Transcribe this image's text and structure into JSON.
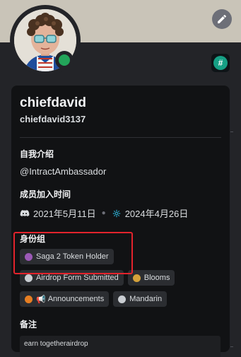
{
  "profile": {
    "display_name": "chiefdavid",
    "username": "chiefdavid3137"
  },
  "about": {
    "title": "自我介绍",
    "text": "@IntractAmbassador"
  },
  "member_since": {
    "title": "成员加入时间",
    "discord_date": "2021年5月11日",
    "server_date": "2024年4月26日"
  },
  "roles": {
    "title": "身份组",
    "items": [
      {
        "label": "Saga 2 Token Holder",
        "color": "#9b59b6"
      },
      {
        "label": "Airdrop Form Submitted",
        "color": "#c9cdd2"
      },
      {
        "label": "Blooms",
        "color": "#d4a13a"
      },
      {
        "label": "Announcements",
        "color": "#e67e22",
        "icon": "megaphone-icon",
        "icon_glyph": "📢"
      },
      {
        "label": "Mandarin",
        "color": "#c9cdd2"
      }
    ]
  },
  "note": {
    "title": "备注",
    "text": "earn togetherairdrop"
  },
  "colors": {
    "banner": "#c9c4b8",
    "status_online": "#23a55a",
    "highlight_border": "#e3232c",
    "card_bg": "#111214"
  },
  "icons": {
    "edit": "pencil-icon",
    "server_badge": "hash-icon",
    "discord": "discord-icon",
    "server": "server-icon"
  },
  "server_badge_glyph": "#"
}
